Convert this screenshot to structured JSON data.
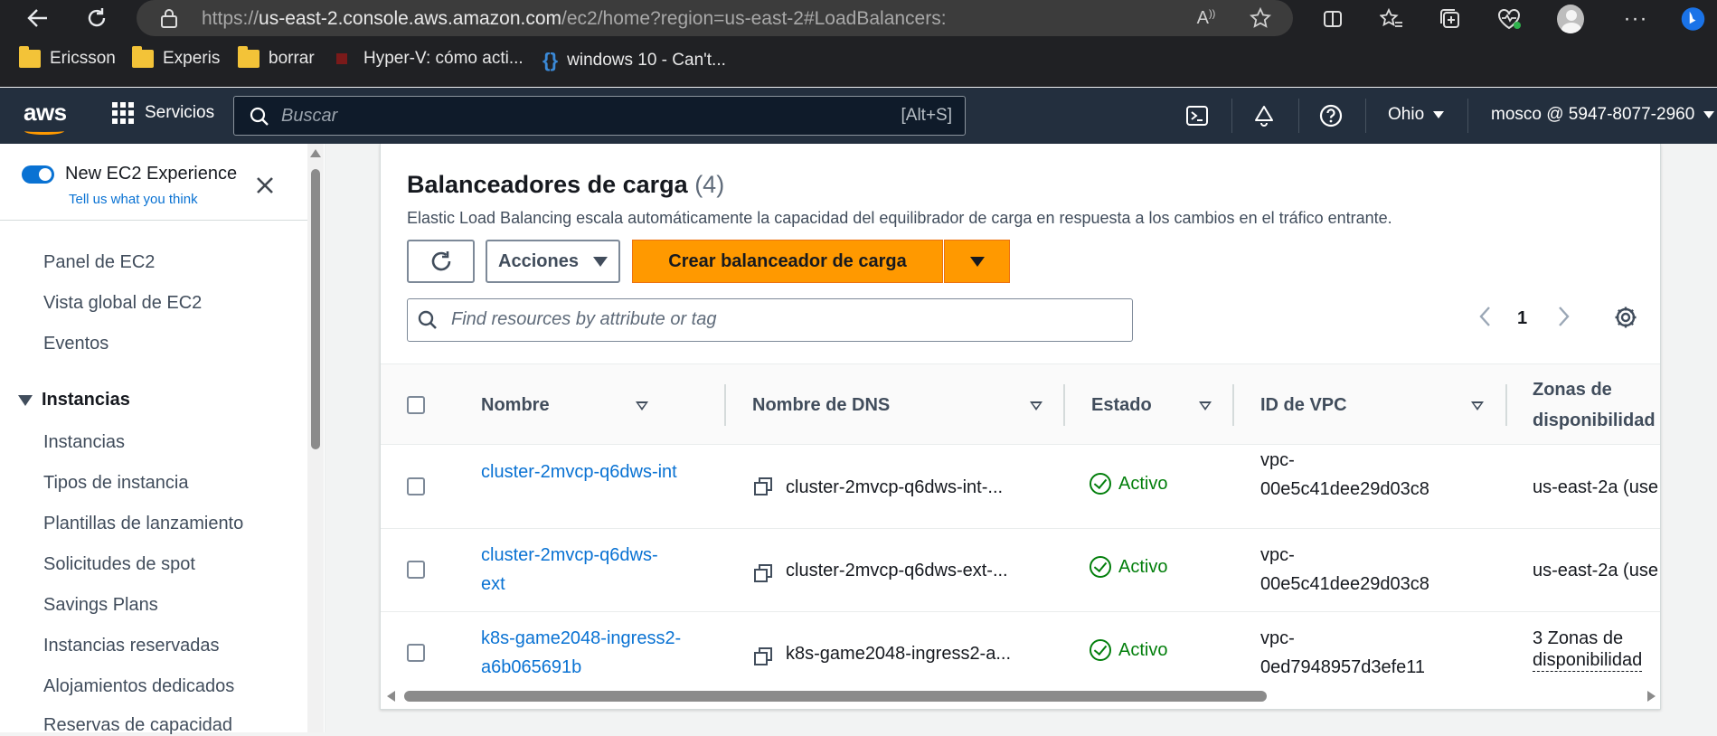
{
  "browser": {
    "url_prefix": "https://",
    "url_host": "us-east-2.console.aws.amazon.com",
    "url_path": "/ec2/home?region=us-east-2#LoadBalancers:",
    "bookmarks": [
      {
        "label": "Ericsson",
        "icon": "folder-icon"
      },
      {
        "label": "Experis",
        "icon": "folder-icon"
      },
      {
        "label": "borrar",
        "icon": "folder-icon"
      },
      {
        "label": "Hyper-V: cómo acti...",
        "icon": "site-favicon"
      },
      {
        "label": "windows 10 - Can't...",
        "icon": "braces-icon"
      }
    ]
  },
  "aws_header": {
    "logo": "aws",
    "services_label": "Servicios",
    "search_placeholder": "Buscar",
    "search_shortcut": "[Alt+S]",
    "region": "Ohio",
    "account": "mosco @ 5947-8077-2960"
  },
  "sidebar": {
    "new_experience_label": "New EC2 Experience",
    "feedback_link": "Tell us what you think",
    "top_items": [
      "Panel de EC2",
      "Vista global de EC2",
      "Eventos"
    ],
    "section_title": "Instancias",
    "section_items": [
      "Instancias",
      "Tipos de instancia",
      "Plantillas de lanzamiento",
      "Solicitudes de spot",
      "Savings Plans",
      "Instancias reservadas",
      "Alojamientos dedicados",
      "Reservas de capacidad"
    ]
  },
  "panel": {
    "title": "Balanceadores de carga",
    "count": "(4)",
    "description": "Elastic Load Balancing escala automáticamente la capacidad del equilibrador de carga en respuesta a los cambios en el tráfico entrante.",
    "actions_label": "Acciones",
    "create_label": "Crear balanceador de carga",
    "filter_placeholder": "Find resources by attribute or tag",
    "page_number": "1",
    "columns": {
      "name": "Nombre",
      "dns": "Nombre de DNS",
      "state": "Estado",
      "vpc": "ID de VPC",
      "zones_line1": "Zonas de",
      "zones_line2": "disponibilidad"
    },
    "rows": [
      {
        "name_line1": "cluster-2mvcp-q6dws-int",
        "name_line2": "",
        "dns": "cluster-2mvcp-q6dws-int-...",
        "state": "Activo",
        "vpc_line1": "vpc-",
        "vpc_line2": "00e5c41dee29d03c8",
        "zones_line1": "us-east-2a (use",
        "zones_line2": ""
      },
      {
        "name_line1": "cluster-2mvcp-q6dws-",
        "name_line2": "ext",
        "dns": "cluster-2mvcp-q6dws-ext-...",
        "state": "Activo",
        "vpc_line1": "vpc-",
        "vpc_line2": "00e5c41dee29d03c8",
        "zones_line1": "us-east-2a (use",
        "zones_line2": ""
      },
      {
        "name_line1": "k8s-game2048-ingress2-",
        "name_line2": "a6b065691b",
        "dns": "k8s-game2048-ingress2-a...",
        "state": "Activo",
        "vpc_line1": "vpc-",
        "vpc_line2": "0ed7948957d3efe11",
        "zones_line1": "3 Zonas de",
        "zones_line2": "disponibilidad"
      }
    ]
  },
  "colors": {
    "aws_header": "#232f3e",
    "primary": "#ff9900",
    "link": "#0972d3",
    "success": "#037f0c"
  }
}
